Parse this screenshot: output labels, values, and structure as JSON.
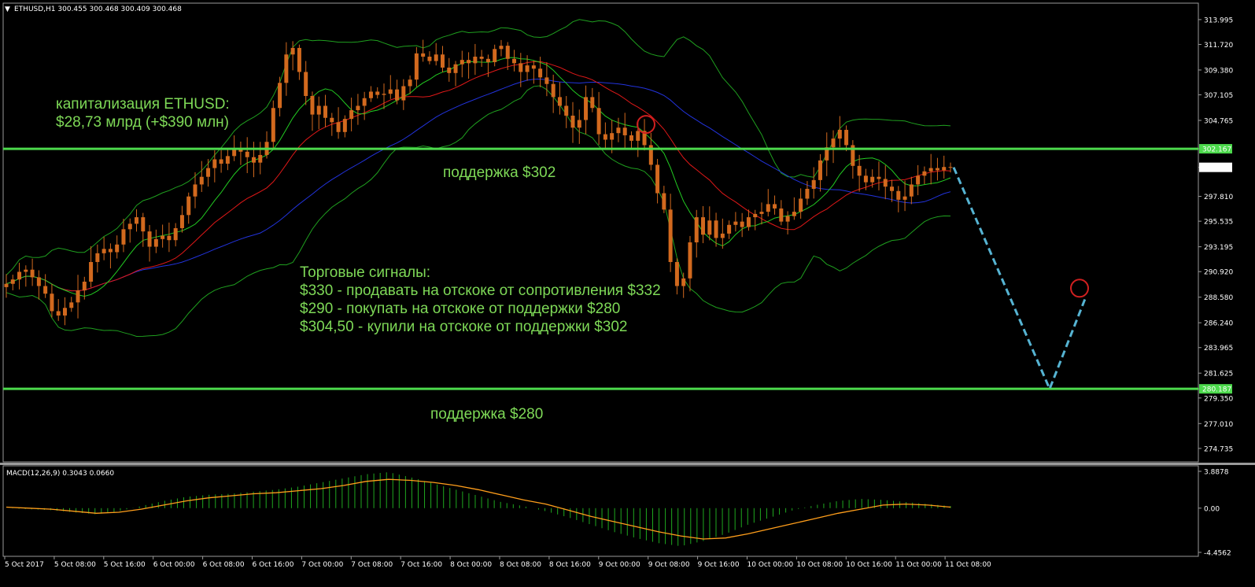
{
  "window": {
    "symbol_header": "ETHUSD,H1  300.455 300.468 300.409 300.468",
    "macd_header": "MACD(12,26,9) 0.3043 0.0660"
  },
  "colors": {
    "background": "#000000",
    "up_candle": "#d2691e",
    "down_candle": "#d2691e",
    "support_line": "#4cd94c",
    "ma_fast": "#22cc22",
    "ma_mid": "#e01818",
    "ma_slow": "#2233dd",
    "bollinger": "#1f9f1f",
    "forecast": "#56b4d3",
    "macd_hist": "#1fa81f",
    "macd_signal": "#ff9e1b",
    "text_annotation": "#7ed957"
  },
  "annotations": {
    "cap_line1": "капитализация ETHUSD:",
    "cap_line2": "$28,73 млрд (+$390 млн)",
    "support_302": "поддержка $302",
    "support_280": "поддержка $280",
    "signals_title": "Торговые сигналы:",
    "signal_1": "$330 - продавать на отскоке от сопротивления $332",
    "signal_2": "$290 - покупать на отскоке от поддержки $280",
    "signal_3": "$304,50 - купили на отскоке от поддержки $302"
  },
  "chart_data": {
    "type": "candlestick",
    "price_axis_labels": [
      "313.995",
      "311.720",
      "309.380",
      "307.105",
      "304.765",
      "302.167",
      "300.468",
      "297.810",
      "295.535",
      "293.195",
      "290.920",
      "288.580",
      "286.240",
      "283.965",
      "281.625",
      "280.187",
      "279.350",
      "277.010",
      "274.735"
    ],
    "price_ylim": [
      273.5,
      315.5
    ],
    "support_levels": [
      302.167,
      280.187
    ],
    "current_price": 300.468,
    "time_labels": [
      "5 Oct 2017",
      "5 Oct 08:00",
      "5 Oct 16:00",
      "6 Oct 00:00",
      "6 Oct 08:00",
      "6 Oct 16:00",
      "7 Oct 00:00",
      "7 Oct 08:00",
      "7 Oct 16:00",
      "8 Oct 00:00",
      "8 Oct 08:00",
      "8 Oct 16:00",
      "9 Oct 00:00",
      "9 Oct 08:00",
      "9 Oct 16:00",
      "10 Oct 00:00",
      "10 Oct 08:00",
      "10 Oct 16:00",
      "11 Oct 00:00",
      "11 Oct 08:00"
    ],
    "close_path": [
      289.8,
      290.2,
      290.9,
      291.1,
      290.4,
      289.6,
      288.9,
      287.3,
      286.9,
      287.6,
      288.1,
      289.2,
      290.0,
      291.8,
      292.6,
      293.0,
      292.7,
      293.4,
      294.8,
      295.3,
      295.9,
      294.6,
      293.2,
      293.9,
      294.2,
      293.8,
      294.9,
      296.1,
      297.8,
      298.9,
      299.6,
      300.4,
      301.2,
      300.8,
      301.5,
      302.2,
      301.9,
      301.4,
      300.9,
      301.6,
      302.8,
      305.9,
      308.2,
      310.8,
      311.4,
      309.2,
      307.0,
      305.3,
      306.1,
      305.0,
      304.6,
      303.7,
      304.9,
      305.7,
      306.1,
      306.8,
      307.4,
      307.1,
      307.2,
      307.6,
      306.6,
      307.9,
      308.5,
      310.9,
      310.6,
      310.2,
      310.8,
      309.6,
      309.1,
      309.9,
      310.3,
      310.0,
      310.6,
      310.4,
      310.1,
      311.3,
      311.6,
      310.4,
      310.0,
      309.2,
      309.8,
      309.5,
      308.7,
      308.1,
      306.9,
      306.1,
      305.2,
      304.1,
      304.8,
      306.9,
      305.9,
      303.5,
      303.0,
      303.6,
      304.1,
      303.4,
      302.9,
      303.8,
      302.5,
      300.7,
      298.1,
      296.6,
      291.8,
      289.6,
      290.3,
      293.6,
      295.9,
      294.3,
      295.6,
      294.0,
      294.4,
      295.2,
      295.5,
      295.0,
      295.9,
      296.2,
      296.4,
      297.1,
      296.7,
      295.5,
      296.0,
      296.4,
      297.6,
      298.5,
      299.3,
      301.1,
      302.3,
      303.1,
      303.9,
      302.5,
      300.6,
      299.7,
      299.1,
      299.6,
      299.4,
      298.7,
      298.3,
      297.5,
      297.8,
      298.9,
      299.7,
      300.1,
      300.4,
      300.2,
      300.5,
      300.468
    ],
    "forecast_path": [
      [
        300.468,
        280.187
      ],
      [
        280.187,
        288.6
      ]
    ],
    "macd": {
      "ylim": [
        -4.4562,
        3.8878
      ],
      "labels": [
        "3.8878",
        "0.00",
        "-4.4562"
      ],
      "signal_series": [
        0.1,
        0.0,
        -0.1,
        -0.3,
        -0.5,
        -0.4,
        -0.1,
        0.3,
        0.7,
        1.0,
        1.2,
        1.4,
        1.5,
        1.7,
        1.9,
        2.2,
        2.6,
        2.8,
        2.7,
        2.5,
        2.2,
        1.8,
        1.3,
        0.8,
        0.4,
        -0.2,
        -0.8,
        -1.3,
        -1.8,
        -2.3,
        -2.7,
        -3.0,
        -2.9,
        -2.5,
        -2.0,
        -1.5,
        -1.0,
        -0.5,
        -0.1,
        0.3,
        0.4,
        0.3,
        0.1
      ],
      "hist_series": [
        0.0,
        -0.1,
        -0.2,
        -0.4,
        -0.6,
        -0.3,
        0.2,
        0.7,
        1.1,
        1.3,
        1.4,
        1.6,
        1.8,
        2.1,
        2.5,
        2.9,
        3.3,
        3.5,
        3.0,
        2.4,
        1.8,
        1.2,
        0.6,
        0.2,
        -0.3,
        -0.9,
        -1.6,
        -2.3,
        -2.9,
        -3.4,
        -3.7,
        -3.2,
        -2.5,
        -1.6,
        -0.9,
        -0.2,
        0.3,
        0.7,
        0.9,
        0.8,
        0.6,
        0.4,
        0.2
      ]
    }
  }
}
